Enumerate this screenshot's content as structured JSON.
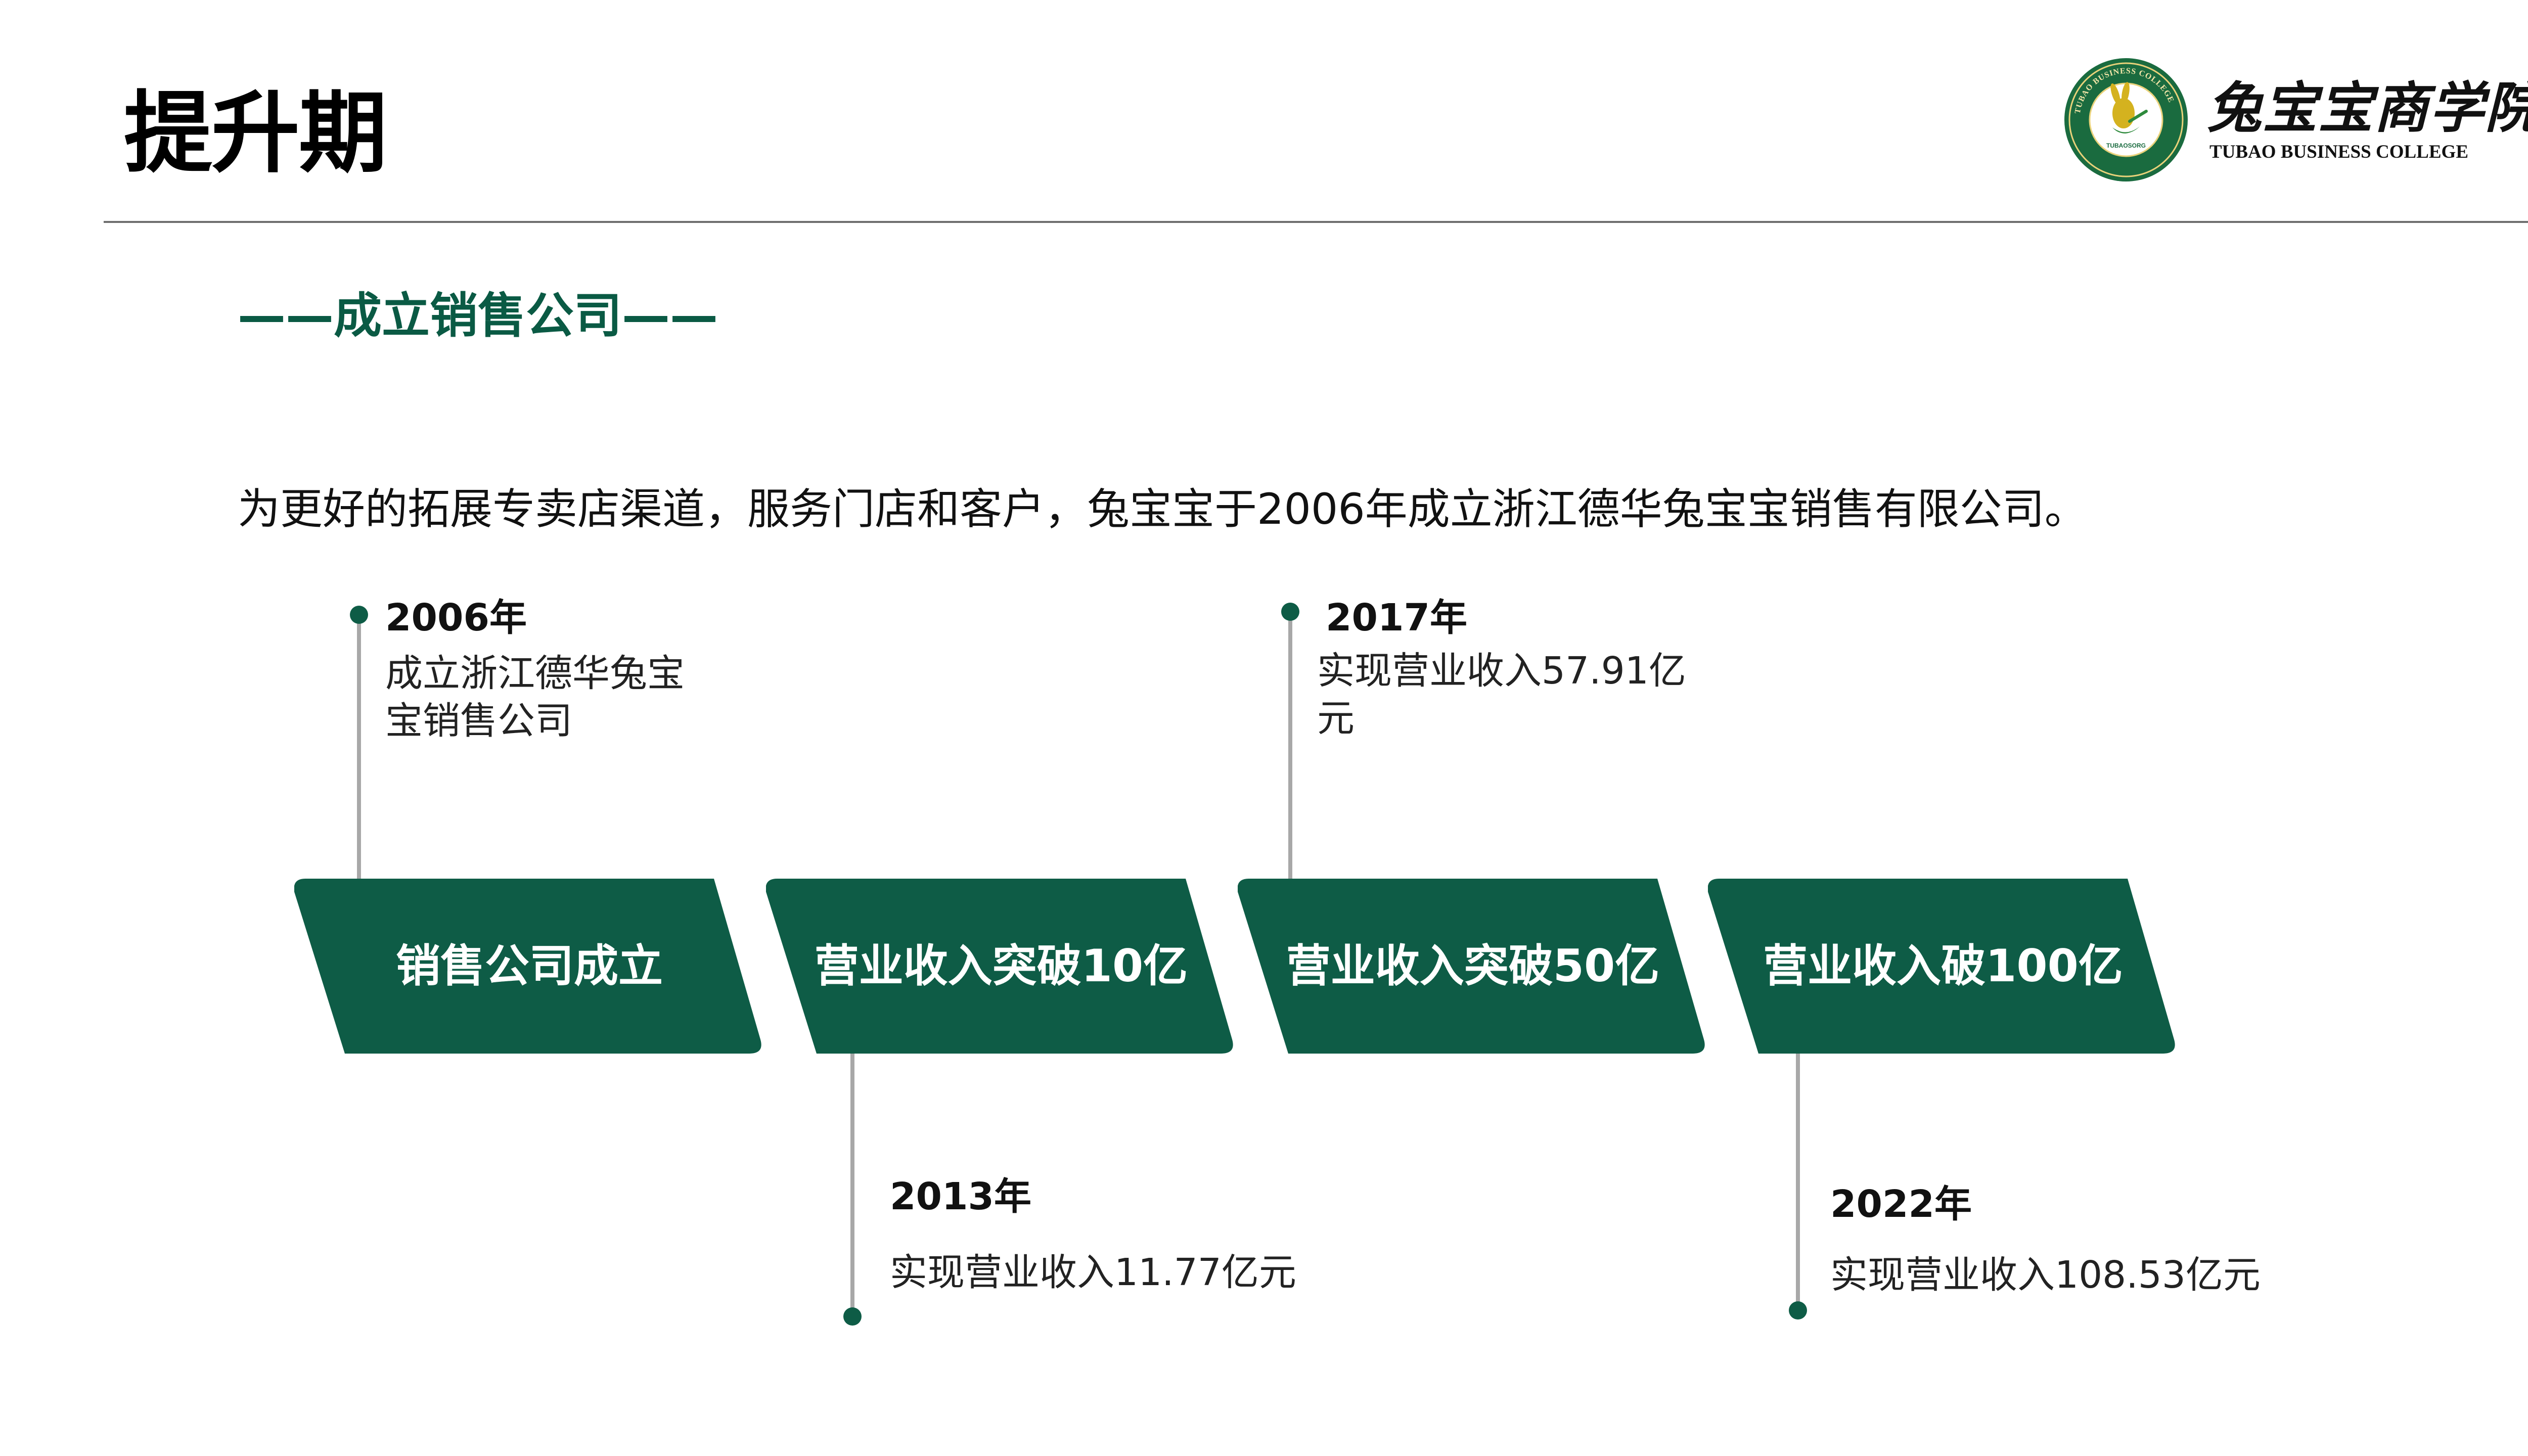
{
  "page": {
    "title": "提升期"
  },
  "logo": {
    "name_cn": "兔宝宝商学院",
    "name_en": "TUBAO BUSINESS COLLEGE",
    "ring_text": "TUBAO BUSINESS COLLEGE",
    "badge_text": "TUBAOSORG"
  },
  "section": {
    "title": "——成立销售公司——",
    "intro": "为更好的拓展专卖店渠道，服务门店和客户，兔宝宝于2006年成立浙江德华兔宝宝销售有限公司。"
  },
  "timeline": {
    "stages": [
      {
        "label": "销售公司成立"
      },
      {
        "label": "营业收入突破10亿"
      },
      {
        "label": "营业收入突破50亿"
      },
      {
        "label": "营业收入破100亿"
      }
    ],
    "events": [
      {
        "year": "2006年",
        "desc": "成立浙江德华兔宝宝销售公司"
      },
      {
        "year": "2013年",
        "desc": "实现营业收入11.77亿元"
      },
      {
        "year": "2017年",
        "desc": "实现营业收入57.91亿元"
      },
      {
        "year": "2022年",
        "desc": "实现营业收入108.53亿元"
      }
    ]
  },
  "colors": {
    "brand_green": "#0a5a44",
    "stem_gray": "#a8a8a8",
    "rule_gray": "#6f6f6f"
  }
}
